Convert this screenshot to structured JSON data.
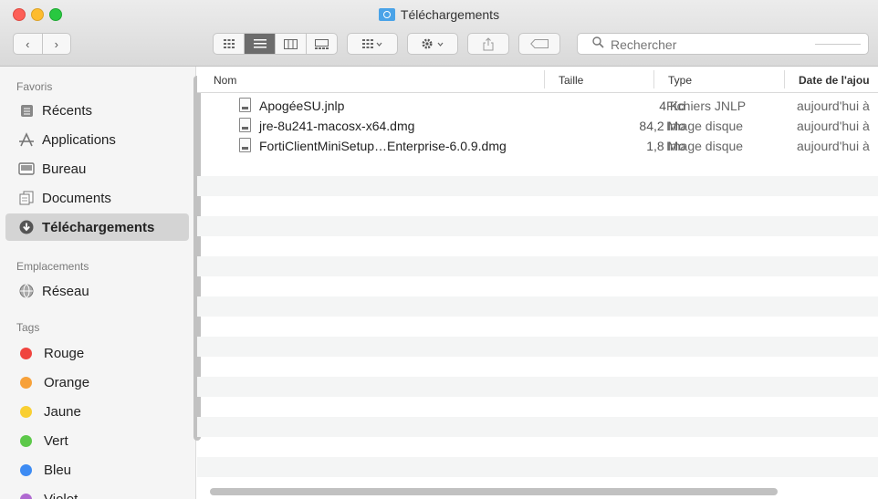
{
  "window": {
    "title": "Téléchargements"
  },
  "toolbar": {
    "back": "‹",
    "forward": "›",
    "search_placeholder": "Rechercher"
  },
  "sidebar": {
    "favorites_header": "Favoris",
    "favorites": [
      {
        "label": "Récents",
        "icon": "recents-icon"
      },
      {
        "label": "Applications",
        "icon": "applications-icon"
      },
      {
        "label": "Bureau",
        "icon": "desktop-icon"
      },
      {
        "label": "Documents",
        "icon": "documents-icon"
      },
      {
        "label": "Téléchargements",
        "icon": "downloads-icon",
        "active": true
      }
    ],
    "locations_header": "Emplacements",
    "locations": [
      {
        "label": "Réseau",
        "icon": "network-icon"
      }
    ],
    "tags_header": "Tags",
    "tags": [
      {
        "label": "Rouge",
        "color": "#f0443f"
      },
      {
        "label": "Orange",
        "color": "#f7a13a"
      },
      {
        "label": "Jaune",
        "color": "#f9cf32"
      },
      {
        "label": "Vert",
        "color": "#5dc94a"
      },
      {
        "label": "Bleu",
        "color": "#3d8bf3"
      },
      {
        "label": "Violet",
        "color": "#b06ad1"
      }
    ]
  },
  "columns": {
    "name": "Nom",
    "size": "Taille",
    "type": "Type",
    "date": "Date de l'ajou"
  },
  "files": [
    {
      "name": "ApogéeSU.jnlp",
      "size": "4 Ko",
      "type": "Fichiers JNLP",
      "date": "aujourd'hui à"
    },
    {
      "name": "jre-8u241-macosx-x64.dmg",
      "size": "84,2 Mo",
      "type": "Image disque",
      "date": "aujourd'hui à"
    },
    {
      "name": "FortiClientMiniSetup…Enterprise-6.0.9.dmg",
      "size": "1,8 Mo",
      "type": "Image disque",
      "date": "aujourd'hui à"
    }
  ]
}
